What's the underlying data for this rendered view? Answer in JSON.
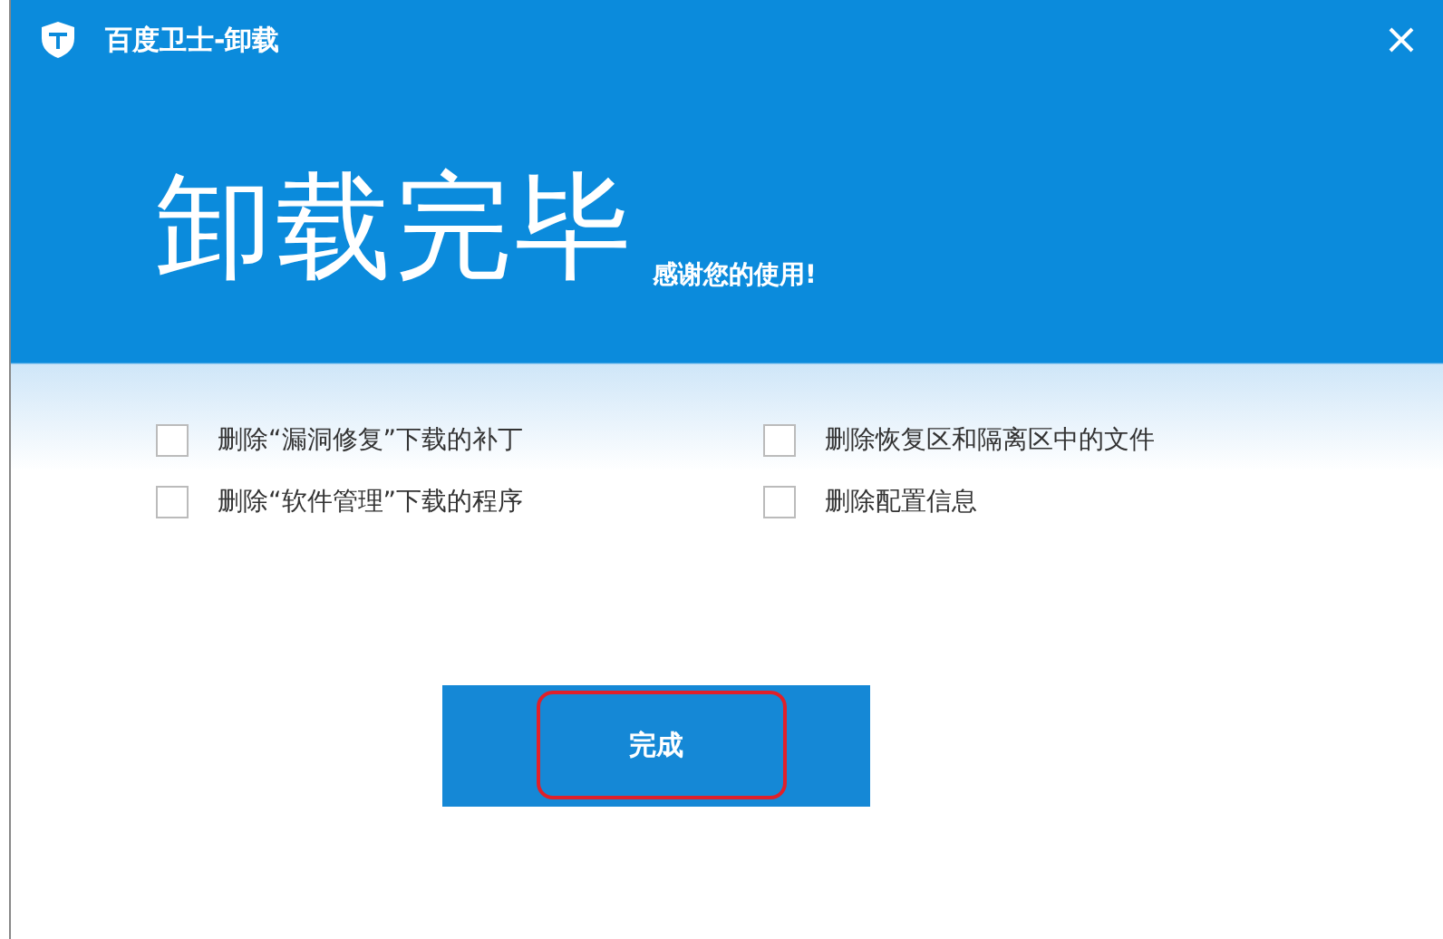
{
  "window": {
    "title": "百度卫士-卸载"
  },
  "heading": "卸载完毕",
  "subheading": "感谢您的使用!",
  "options": [
    {
      "label": "删除“漏洞修复”下载的补丁",
      "checked": false
    },
    {
      "label": "删除恢复区和隔离区中的文件",
      "checked": false
    },
    {
      "label": "删除“软件管理”下载的程序",
      "checked": false
    },
    {
      "label": "删除配置信息",
      "checked": false
    }
  ],
  "buttons": [
    {
      "label": "完成"
    }
  ]
}
